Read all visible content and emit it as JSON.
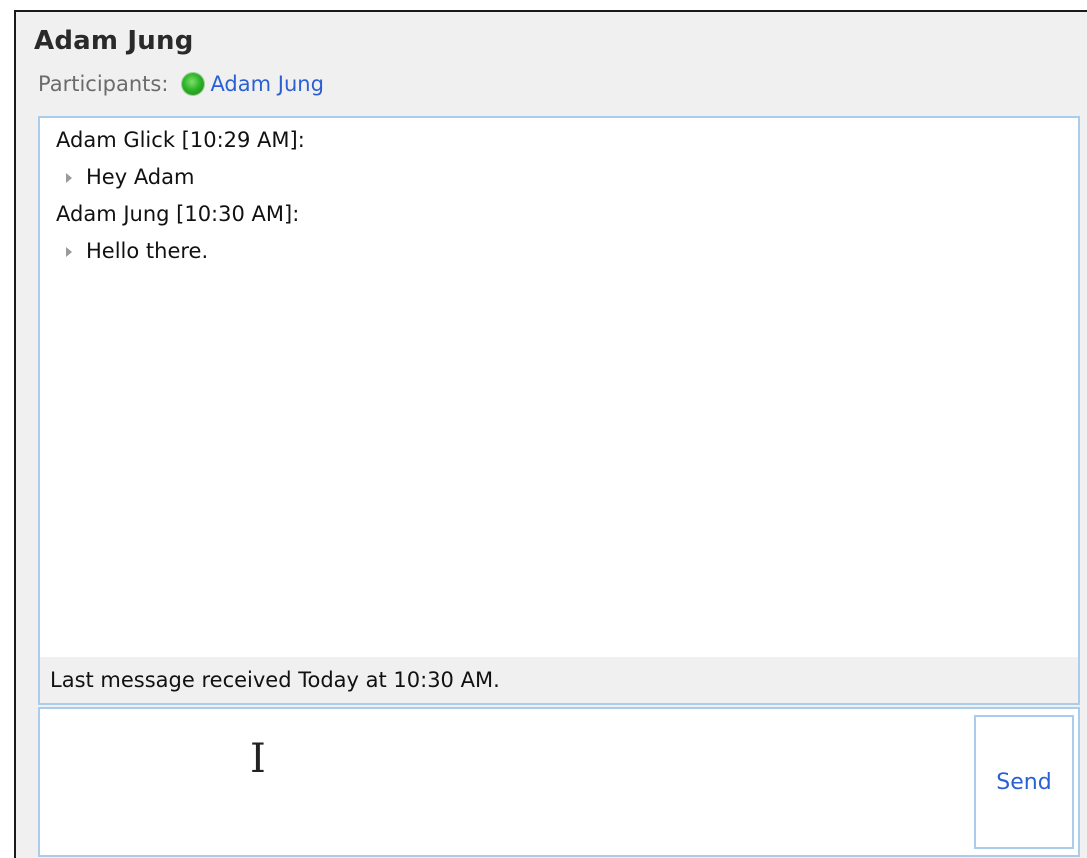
{
  "header": {
    "title": "Adam Jung",
    "participants_label": "Participants:",
    "participant_name": "Adam Jung",
    "participant_status_color": "#2fb52a"
  },
  "transcript": {
    "messages": [
      {
        "header": "Adam Glick [10:29 AM]:",
        "body": "Hey Adam"
      },
      {
        "header": "Adam Jung [10:30 AM]:",
        "body": "Hello there."
      }
    ],
    "status": "Last message received Today at 10:30 AM."
  },
  "composer": {
    "input_value": "",
    "send_label": "Send",
    "cursor_icon": "text-cursor-icon"
  },
  "colors": {
    "accent_link": "#2b5fd4",
    "panel_border": "#a9cdea",
    "background": "#f0f0f0"
  }
}
